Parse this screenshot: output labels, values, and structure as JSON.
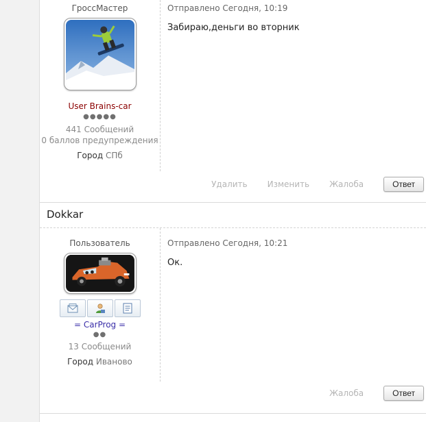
{
  "posts": [
    {
      "rank": "ГроссМастер",
      "username": "User Brains-car",
      "username_color": "#8b0000",
      "pips": "●●●●●",
      "messages": "441 Сообщений",
      "warnings": "0 баллов предупреждения",
      "city_label": "Город",
      "city": "СПб",
      "posted": "Отправлено Сегодня, 10:19",
      "text": "Забираю,деньги во вторник",
      "actions": [
        "Удалить",
        "Изменить",
        "Жалоба"
      ],
      "reply": "Ответ"
    },
    {
      "author": "Dokkar",
      "rank": "Пользователь",
      "username": "= CarProg =",
      "username_color": "#3a2ea8",
      "pips": "●●",
      "messages": "13 Сообщений",
      "city_label": "Город",
      "city": "Иваново",
      "posted": "Отправлено Сегодня, 10:21",
      "text": "Ок.",
      "actions": [
        "Жалоба"
      ],
      "reply": "Ответ"
    }
  ],
  "icons": [
    "envelope-icon",
    "user-card-icon",
    "document-icon"
  ]
}
